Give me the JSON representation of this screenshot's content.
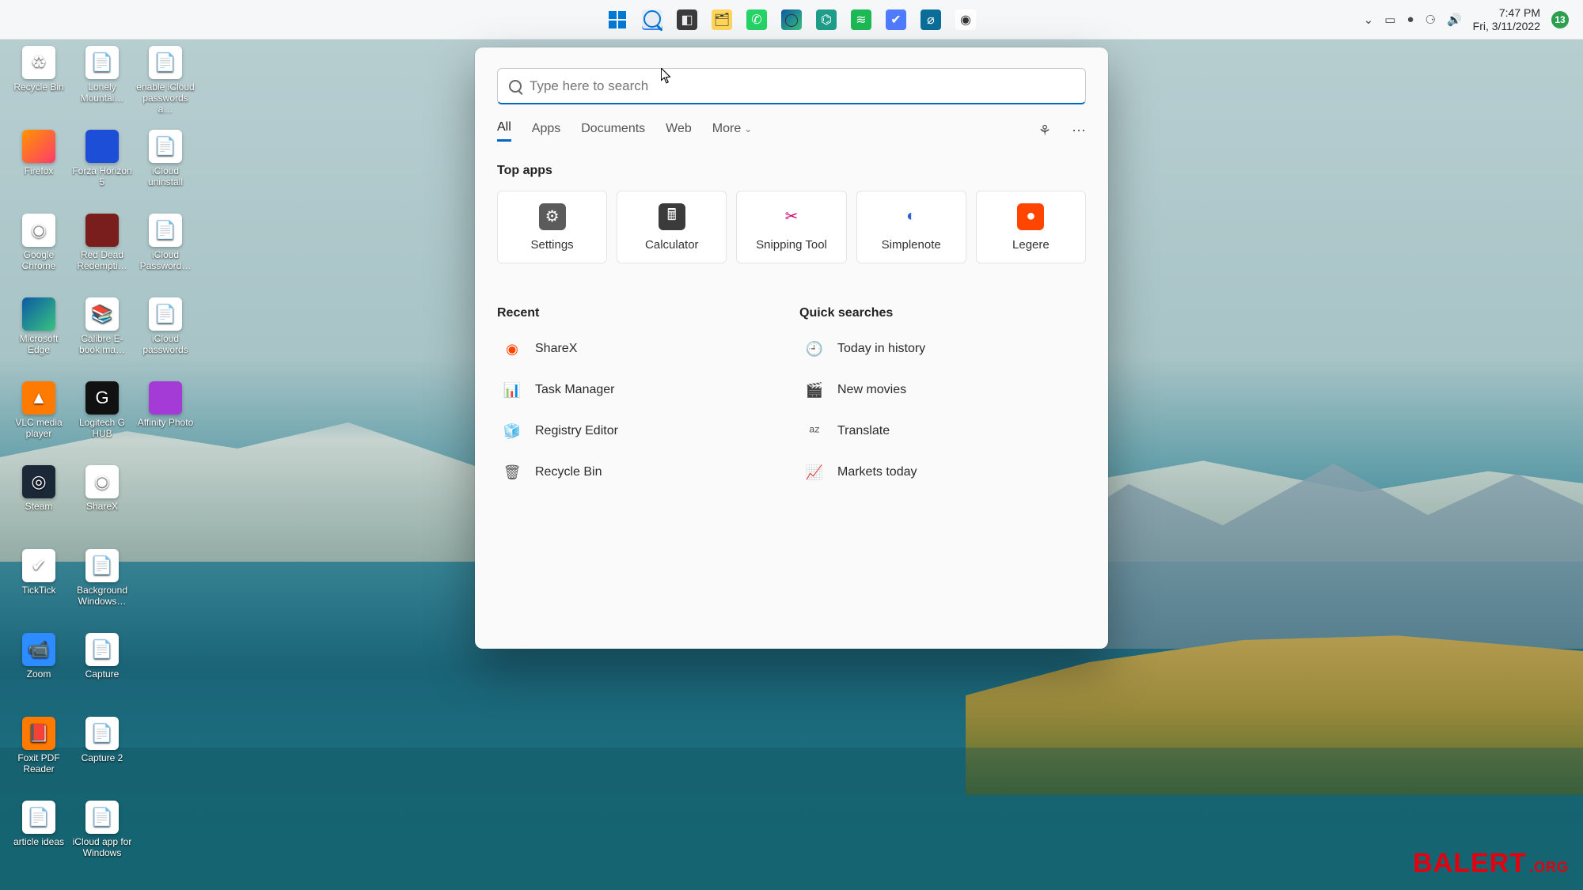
{
  "taskbar": {
    "time": "7:47 PM",
    "date": "Fri, 3/11/2022",
    "notification_count": "13",
    "apps": [
      {
        "name": "start",
        "glyph": ""
      },
      {
        "name": "search",
        "glyph": ""
      },
      {
        "name": "task-view",
        "glyph": "◧",
        "bg": "#3b3b3b",
        "fg": "#eee"
      },
      {
        "name": "file-explorer",
        "glyph": "🗂",
        "bg": "#ffd659"
      },
      {
        "name": "whatsapp",
        "glyph": "✆",
        "bg": "#25d366",
        "fg": "#fff"
      },
      {
        "name": "edge",
        "glyph": "◯",
        "bg": "linear-gradient(135deg,#0c59a4,#39c481)"
      },
      {
        "name": "ai-app",
        "glyph": "⌬",
        "bg": "#1e9e8a",
        "fg": "#fff"
      },
      {
        "name": "spotify",
        "glyph": "≋",
        "bg": "#1db954",
        "fg": "#fff"
      },
      {
        "name": "ticktick-tb",
        "glyph": "✔",
        "bg": "#4f7cff",
        "fg": "#fff"
      },
      {
        "name": "blocker",
        "glyph": "⌀",
        "bg": "#0b6e99",
        "fg": "#fff"
      },
      {
        "name": "chrome-tb",
        "glyph": "◉",
        "bg": "#fff"
      }
    ],
    "tray": [
      {
        "name": "chevron",
        "glyph": "⌄"
      },
      {
        "name": "tray-app-1",
        "glyph": "▭"
      },
      {
        "name": "tray-app-2",
        "glyph": "●"
      },
      {
        "name": "wifi",
        "glyph": "⚆"
      },
      {
        "name": "volume",
        "glyph": "🔊"
      }
    ]
  },
  "desktop_icons": [
    {
      "label": "Recycle Bin",
      "bg": "#ffffff",
      "glyph": "♻"
    },
    {
      "label": "Lonely Mountai…",
      "bg": "#ffffff",
      "glyph": "📄"
    },
    {
      "label": "enable iCloud passwords a…",
      "bg": "#ffffff",
      "glyph": "📄"
    },
    {
      "label": "Firefox",
      "bg": "linear-gradient(135deg,#ff9500,#ff3b6b)",
      "glyph": ""
    },
    {
      "label": "Forza Horizon 5",
      "bg": "#1d4ed8",
      "glyph": ""
    },
    {
      "label": "iCloud uninstall",
      "bg": "#ffffff",
      "glyph": "📄"
    },
    {
      "label": "Google Chrome",
      "bg": "#ffffff",
      "glyph": "◉"
    },
    {
      "label": "Red Dead Redempti…",
      "bg": "#7a1d1d",
      "glyph": ""
    },
    {
      "label": "iCloud Password…",
      "bg": "#ffffff",
      "glyph": "📄"
    },
    {
      "label": "Microsoft Edge",
      "bg": "linear-gradient(135deg,#0c59a4,#39c481)",
      "glyph": ""
    },
    {
      "label": "Calibre E-book ma…",
      "bg": "#ffffff",
      "glyph": "📚"
    },
    {
      "label": "iCloud passwords",
      "bg": "#ffffff",
      "glyph": "📄"
    },
    {
      "label": "VLC media player",
      "bg": "#ff7a00",
      "glyph": "▲"
    },
    {
      "label": "Logitech G HUB",
      "bg": "#111111",
      "glyph": "G"
    },
    {
      "label": "Affinity Photo",
      "bg": "#a53bd6",
      "glyph": ""
    },
    {
      "label": "Steam",
      "bg": "#1b2838",
      "glyph": "◎"
    },
    {
      "label": "ShareX",
      "bg": "#ffffff",
      "glyph": "◉"
    },
    {
      "label": "",
      "bg": "",
      "glyph": ""
    },
    {
      "label": "TickTick",
      "bg": "#ffffff",
      "glyph": "✔"
    },
    {
      "label": "Background Windows…",
      "bg": "#ffffff",
      "glyph": "📄"
    },
    {
      "label": "",
      "bg": "",
      "glyph": ""
    },
    {
      "label": "Zoom",
      "bg": "#2d8cff",
      "glyph": "📹"
    },
    {
      "label": "Capture",
      "bg": "#ffffff",
      "glyph": "📄"
    },
    {
      "label": "",
      "bg": "",
      "glyph": ""
    },
    {
      "label": "Foxit PDF Reader",
      "bg": "#ff7a00",
      "glyph": "📕"
    },
    {
      "label": "Capture 2",
      "bg": "#ffffff",
      "glyph": "📄"
    },
    {
      "label": "",
      "bg": "",
      "glyph": ""
    },
    {
      "label": "article ideas",
      "bg": "#ffffff",
      "glyph": "📄"
    },
    {
      "label": "iCloud app for Windows",
      "bg": "#ffffff",
      "glyph": "📄"
    }
  ],
  "search": {
    "placeholder": "Type here to search",
    "tabs": {
      "all": "All",
      "apps": "Apps",
      "documents": "Documents",
      "web": "Web",
      "more": "More"
    },
    "top_apps_header": "Top apps",
    "top_apps": [
      {
        "label": "Settings",
        "bg": "#5b5b5b",
        "fg": "#fff",
        "glyph": "⚙"
      },
      {
        "label": "Calculator",
        "bg": "#3b3b3b",
        "fg": "#fff",
        "glyph": "🖩"
      },
      {
        "label": "Snipping Tool",
        "bg": "#ffffff",
        "fg": "#d0006f",
        "glyph": "✂"
      },
      {
        "label": "Simplenote",
        "bg": "#ffffff",
        "fg": "#3361cc",
        "glyph": "◐"
      },
      {
        "label": "Legere",
        "bg": "#ff4500",
        "fg": "#fff",
        "glyph": "●"
      }
    ],
    "recent_header": "Recent",
    "recent": [
      {
        "label": "ShareX",
        "glyph": "◉",
        "color": "#ff4500"
      },
      {
        "label": "Task Manager",
        "glyph": "📊",
        "color": "#0078d4"
      },
      {
        "label": "Registry Editor",
        "glyph": "🧊",
        "color": "#0078d4"
      },
      {
        "label": "Recycle Bin",
        "glyph": "🗑",
        "color": "#555"
      }
    ],
    "quick_header": "Quick searches",
    "quick": [
      {
        "label": "Today in history",
        "glyph": "🕘"
      },
      {
        "label": "New movies",
        "glyph": "🎬"
      },
      {
        "label": "Translate",
        "glyph": "ᵃᶻ"
      },
      {
        "label": "Markets today",
        "glyph": "📈"
      }
    ]
  },
  "watermark": {
    "main": "BALERT",
    "suffix": ".ORG"
  }
}
